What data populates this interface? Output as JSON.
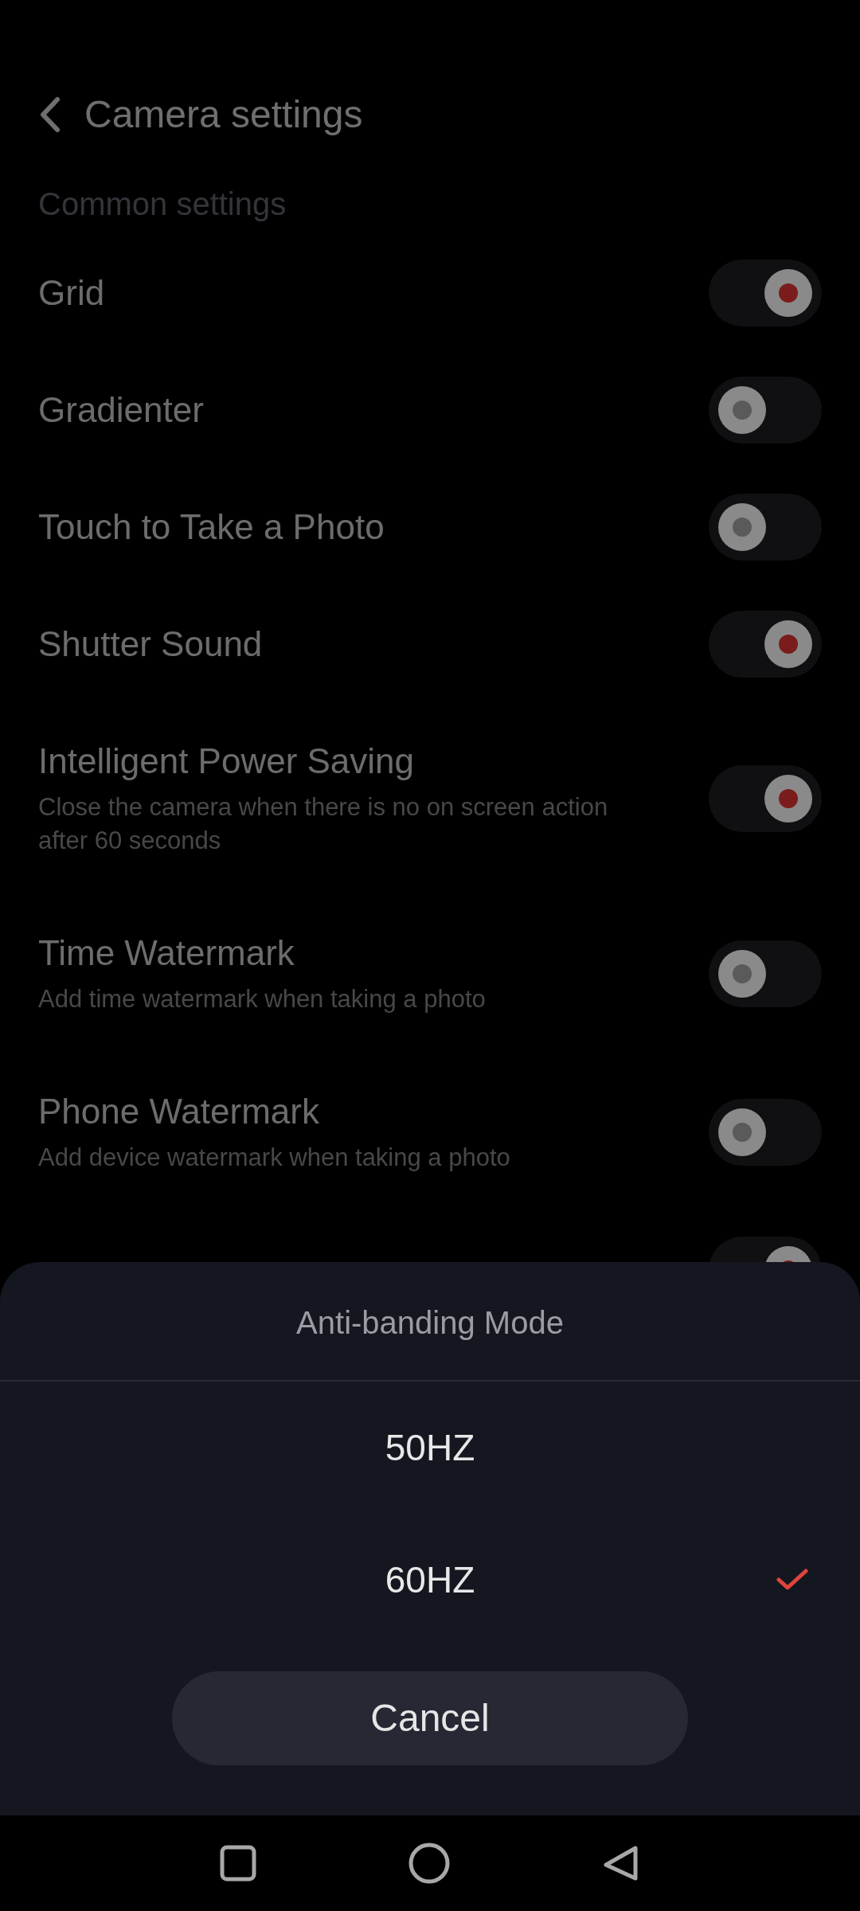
{
  "header": {
    "title": "Camera settings"
  },
  "section_title": "Common settings",
  "settings": [
    {
      "label": "Grid",
      "on": true
    },
    {
      "label": "Gradienter",
      "on": false
    },
    {
      "label": "Touch to Take a Photo",
      "on": false
    },
    {
      "label": "Shutter Sound",
      "on": true
    },
    {
      "label": "Intelligent Power Saving",
      "description": "Close the camera when there is no on screen action after 60 seconds",
      "on": true
    },
    {
      "label": "Time Watermark",
      "description": "Add time watermark when taking a photo",
      "on": false
    },
    {
      "label": "Phone Watermark",
      "description": "Add device watermark when taking a photo",
      "on": false
    },
    {
      "on": true
    }
  ],
  "sheet": {
    "title": "Anti-banding Mode",
    "options": [
      {
        "label": "50HZ",
        "selected": false
      },
      {
        "label": "60HZ",
        "selected": true
      }
    ],
    "cancel": "Cancel"
  }
}
